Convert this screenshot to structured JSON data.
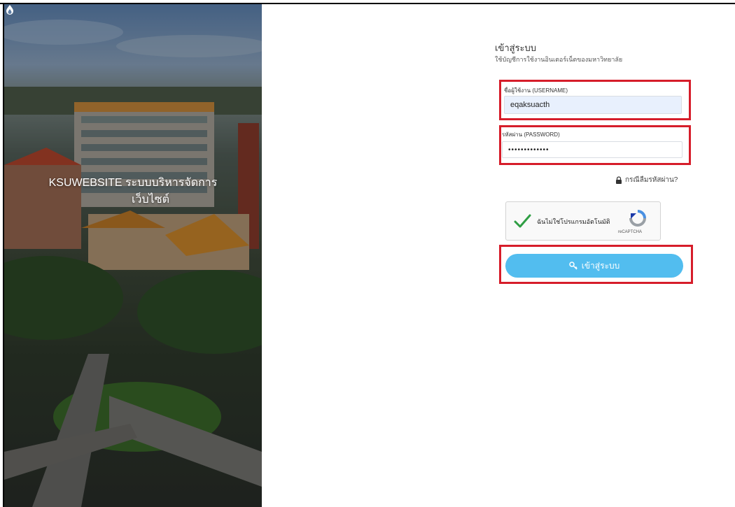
{
  "hero": {
    "title_line1": "KSUWEBSITE ระบบบริหารจัดการ",
    "title_line2": "เว็บไซต์"
  },
  "login": {
    "title": "เข้าสู่ระบบ",
    "subtitle": "ใช้บัญชีการใช้งานอินเตอร์เน็ตของมหาวิทยาลัย",
    "username_label": "ชื่อผู้ใช้งาน (USERNAME)",
    "username_value": "eqaksuacth",
    "password_label": "รหัสผ่าน (PASSWORD)",
    "password_value": "•••••••••••••",
    "forgot_text": "กรณีลืมรหัสผ่าน?",
    "captcha_text": "ฉันไม่ใช่โปรแกรมอัตโนมัติ",
    "captcha_brand": "reCAPTCHA",
    "submit_label": "เข้าสู่ระบบ"
  },
  "colors": {
    "highlight": "#d61d2a",
    "button": "#52bdef",
    "input_filled": "#e8f0fd"
  },
  "icons": {
    "brand": "flame-logo-icon",
    "lock": "lock-icon",
    "check": "checkmark-icon",
    "captcha": "recaptcha-logo-icon",
    "key": "key-icon"
  }
}
